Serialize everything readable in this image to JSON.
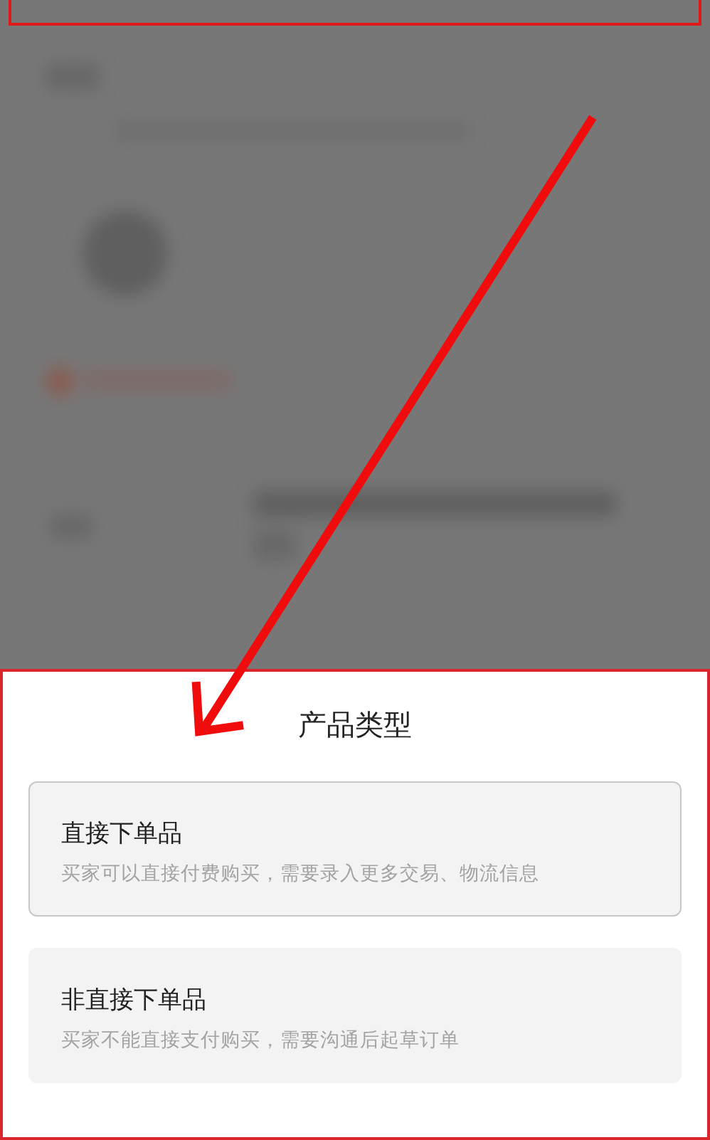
{
  "sheet": {
    "title": "产品类型",
    "options": [
      {
        "title": "直接下单品",
        "description": "买家可以直接付费购买，需要录入更多交易、物流信息",
        "selected": true
      },
      {
        "title": "非直接下单品",
        "description": "买家不能直接支付购买，需要沟通后起草订单",
        "selected": false
      }
    ]
  }
}
